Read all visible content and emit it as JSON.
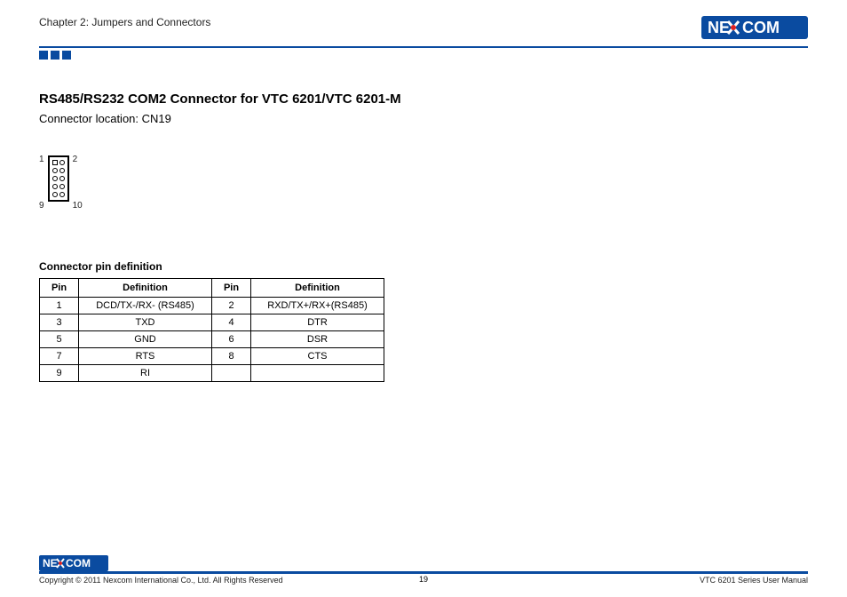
{
  "header": {
    "chapter": "Chapter 2: Jumpers and Connectors",
    "brand": "NEXCOM"
  },
  "main": {
    "title": "RS485/RS232 COM2 Connector for VTC 6201/VTC 6201-M",
    "subtitle": "Connector location: CN19"
  },
  "connector": {
    "label_tl": "1",
    "label_tr": "2",
    "label_bl": "9",
    "label_br": "10"
  },
  "table": {
    "caption": "Connector pin definition",
    "head": {
      "pin": "Pin",
      "def": "Definition"
    },
    "rows": [
      {
        "p1": "1",
        "d1": "DCD/TX-/RX- (RS485)",
        "p2": "2",
        "d2": "RXD/TX+/RX+(RS485)"
      },
      {
        "p1": "3",
        "d1": "TXD",
        "p2": "4",
        "d2": "DTR"
      },
      {
        "p1": "5",
        "d1": "GND",
        "p2": "6",
        "d2": "DSR"
      },
      {
        "p1": "7",
        "d1": "RTS",
        "p2": "8",
        "d2": "CTS"
      },
      {
        "p1": "9",
        "d1": "RI",
        "p2": "",
        "d2": ""
      }
    ]
  },
  "footer": {
    "copyright": "Copyright © 2011 Nexcom International Co., Ltd. All Rights Reserved",
    "page_no": "19",
    "doc": "VTC 6201 Series User Manual"
  }
}
